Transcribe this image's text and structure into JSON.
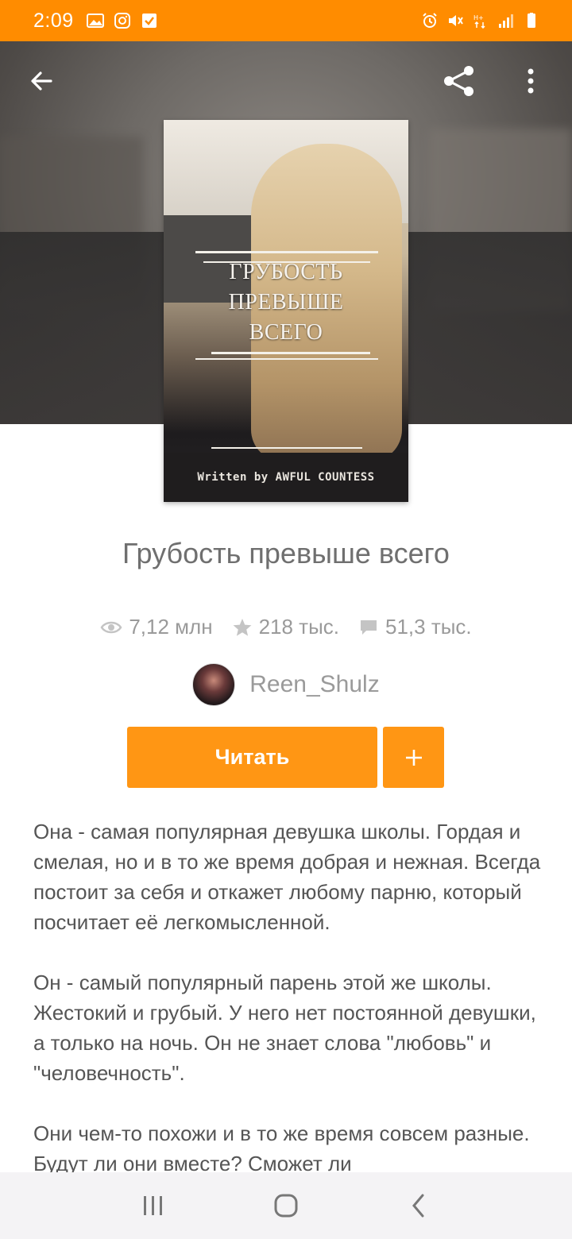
{
  "status_bar": {
    "time": "2:09",
    "left_icons": [
      "gallery-icon",
      "instagram-icon",
      "check-icon"
    ],
    "right_icons": [
      "alarm-icon",
      "mute-icon",
      "data-icon",
      "signal-icon",
      "battery-icon"
    ]
  },
  "header": {
    "back_icon": "arrow-left-icon",
    "share_icon": "share-icon",
    "more_icon": "more-vert-icon"
  },
  "cover": {
    "title_lines": [
      "ГРУБОСТЬ",
      "ПРЕВЫШЕ",
      "ВСЕГО"
    ],
    "footer_text": "Written by AWFUL COUNTESS"
  },
  "story": {
    "title": "Грубость превыше всего",
    "stats": {
      "views": "7,12 млн",
      "votes": "218 тыс.",
      "comments": "51,3 тыс."
    },
    "author": "Reen_Shulz",
    "read_button": "Читать",
    "add_button": "+",
    "description": [
      "Она - самая популярная девушка школы. Гордая и смелая, но и в то же время добрая и нежная. Всегда постоит за себя и откажет любому парню, который посчитает её легкомысленной.",
      "Он - самый популярный парень этой же школы. Жестокий и грубый. У него нет постоянной девушки, а только на ночь. Он не знает слова \"любовь\" и \"человечность\".",
      "Они чем-то похожи и в то же время совсем разные. Будут ли они вместе? Сможет ли"
    ]
  },
  "colors": {
    "accent": "#ff9614",
    "status_bar": "#ff8c00"
  }
}
